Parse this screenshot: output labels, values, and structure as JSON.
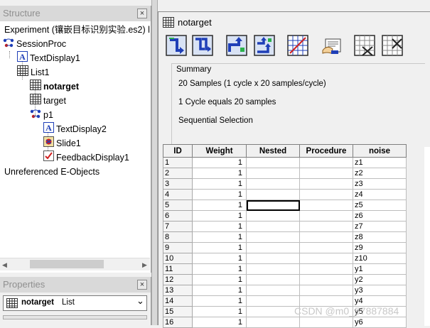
{
  "structure": {
    "title": "Structure",
    "close": "×",
    "experiment": "Experiment (镶嵌目标识别实验.es2) l",
    "session_proc": "SessionProc",
    "text_display1": "TextDisplay1",
    "list1": "List1",
    "notarget": "notarget",
    "target": "target",
    "p1": "p1",
    "text_display2": "TextDisplay2",
    "slide1": "Slide1",
    "feedback_display1": "FeedbackDisplay1",
    "unreferenced": "Unreferenced E-Objects"
  },
  "properties": {
    "title": "Properties",
    "close": "×",
    "selected_name": "notarget",
    "selected_type": "List",
    "chevron": "⌄"
  },
  "list_window": {
    "title": "notarget",
    "toolbar_icons": [
      "add-level-icon",
      "add-multiple-levels-icon",
      "add-attribute-icon",
      "add-multiple-attributes-icon",
      "properties-grid-icon",
      "summary-icon",
      "remove-levels-icon",
      "remove-attributes-icon"
    ],
    "summary": {
      "heading": "Summary",
      "line1": "20 Samples (1 cycle x 20 samples/cycle)",
      "line2": "1 Cycle equals 20 samples",
      "line3": "Sequential Selection"
    },
    "columns": [
      "ID",
      "Weight",
      "Nested",
      "Procedure",
      "noise"
    ],
    "rows": [
      {
        "id": "1",
        "weight": "1",
        "nested": "",
        "procedure": "",
        "noise": "z1"
      },
      {
        "id": "2",
        "weight": "1",
        "nested": "",
        "procedure": "",
        "noise": "z2"
      },
      {
        "id": "3",
        "weight": "1",
        "nested": "",
        "procedure": "",
        "noise": "z3"
      },
      {
        "id": "4",
        "weight": "1",
        "nested": "",
        "procedure": "",
        "noise": "z4"
      },
      {
        "id": "5",
        "weight": "1",
        "nested": "",
        "procedure": "",
        "noise": "z5"
      },
      {
        "id": "6",
        "weight": "1",
        "nested": "",
        "procedure": "",
        "noise": "z6"
      },
      {
        "id": "7",
        "weight": "1",
        "nested": "",
        "procedure": "",
        "noise": "z7"
      },
      {
        "id": "8",
        "weight": "1",
        "nested": "",
        "procedure": "",
        "noise": "z8"
      },
      {
        "id": "9",
        "weight": "1",
        "nested": "",
        "procedure": "",
        "noise": "z9"
      },
      {
        "id": "10",
        "weight": "1",
        "nested": "",
        "procedure": "",
        "noise": "z10"
      },
      {
        "id": "11",
        "weight": "1",
        "nested": "",
        "procedure": "",
        "noise": "y1"
      },
      {
        "id": "12",
        "weight": "1",
        "nested": "",
        "procedure": "",
        "noise": "y2"
      },
      {
        "id": "13",
        "weight": "1",
        "nested": "",
        "procedure": "",
        "noise": "y3"
      },
      {
        "id": "14",
        "weight": "1",
        "nested": "",
        "procedure": "",
        "noise": "y4"
      },
      {
        "id": "15",
        "weight": "1",
        "nested": "",
        "procedure": "",
        "noise": "y5"
      },
      {
        "id": "16",
        "weight": "1",
        "nested": "",
        "procedure": "",
        "noise": "y6"
      }
    ]
  },
  "watermark": "CSDN @m0_57887884"
}
